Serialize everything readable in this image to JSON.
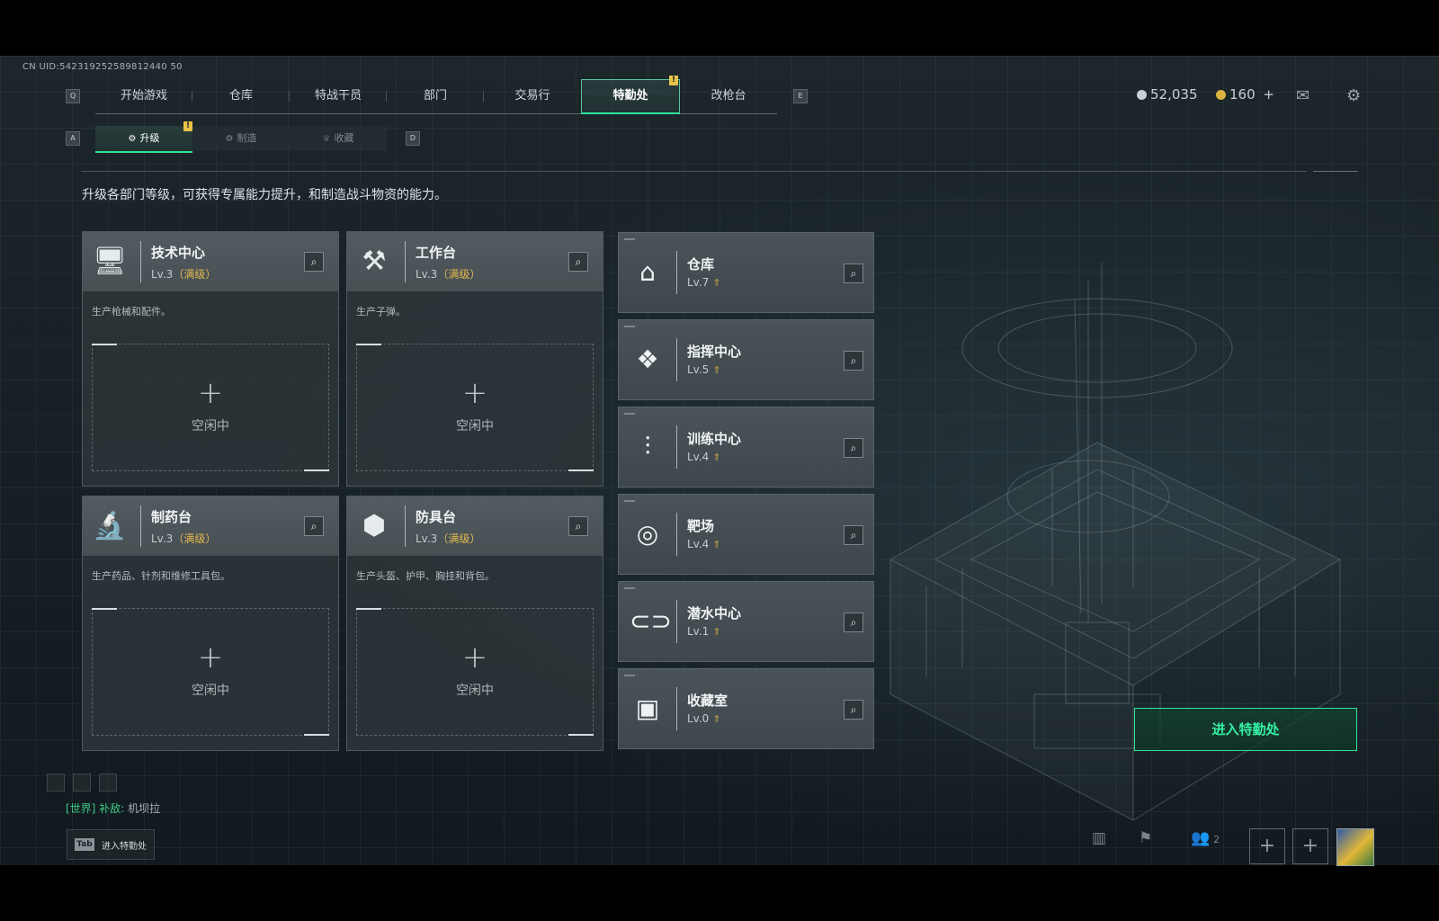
{
  "uid": "CN UID:542319252589812440 50",
  "nav": {
    "left_key": "Q",
    "right_key": "E",
    "tabs": [
      "开始游戏",
      "仓库",
      "特战干员",
      "部门",
      "交易行",
      "特勤处",
      "改枪台"
    ],
    "active_index": 5,
    "badge": "!"
  },
  "subnav": {
    "left_key": "A",
    "right_key": "D",
    "tabs": [
      "升级",
      "制造",
      "收藏"
    ],
    "active_index": 0,
    "badge": "!"
  },
  "currency": {
    "silver": "52,035",
    "gold": "160"
  },
  "description": "升级各部门等级，可获得专属能力提升，和制造战斗物资的能力。",
  "cards": [
    {
      "title": "技术中心",
      "level": "Lv.3",
      "max": "（满级）",
      "desc": "生产枪械和配件。",
      "slot": "空闲中",
      "icon": "monitor-icon"
    },
    {
      "title": "工作台",
      "level": "Lv.3",
      "max": "（满级）",
      "desc": "生产子弹。",
      "slot": "空闲中",
      "icon": "hammer-wrench-icon"
    },
    {
      "title": "制药台",
      "level": "Lv.3",
      "max": "（满级）",
      "desc": "生产药品、针剂和维修工具包。",
      "slot": "空闲中",
      "icon": "microscope-icon"
    },
    {
      "title": "防具台",
      "level": "Lv.3",
      "max": "（满级）",
      "desc": "生产头盔、护甲、胸挂和背包。",
      "slot": "空闲中",
      "icon": "cubes-icon"
    }
  ],
  "departments": [
    {
      "title": "仓库",
      "level": "Lv.7",
      "icon": "warehouse-icon"
    },
    {
      "title": "指挥中心",
      "level": "Lv.5",
      "icon": "command-icon"
    },
    {
      "title": "训练中心",
      "level": "Lv.4",
      "icon": "dumbbell-icon"
    },
    {
      "title": "靶场",
      "level": "Lv.4",
      "icon": "target-icon"
    },
    {
      "title": "潜水中心",
      "level": "Lv.1",
      "icon": "diving-mask-icon"
    },
    {
      "title": "收藏室",
      "level": "Lv.0",
      "icon": "display-case-icon"
    }
  ],
  "enter_button": "进入特勤处",
  "chat": {
    "channel": "[世界]",
    "sender": "补敌:",
    "message": "机坝拉"
  },
  "tab_hint": {
    "key": "Tab",
    "text": "进入特勤处"
  },
  "friends_count": "2",
  "colors": {
    "accent": "#2ee59a",
    "max_level": "#e3b94c",
    "badge": "#e8c34a"
  }
}
